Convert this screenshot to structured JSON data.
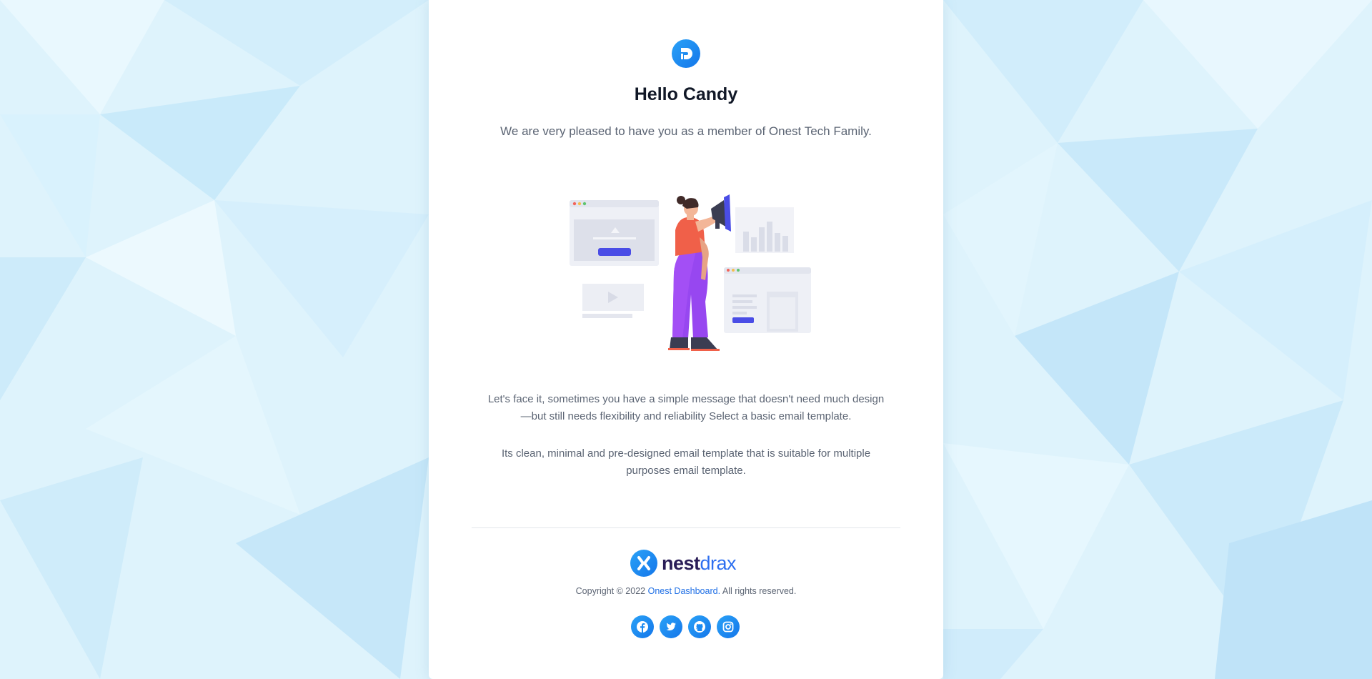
{
  "colors": {
    "accent": "#1a8af2",
    "brand_dark": "#2a1d57",
    "brand_light": "#2d6ff0",
    "text_heading": "#111827",
    "text_body": "#5b6473",
    "background": "#dff3fc"
  },
  "header": {
    "logo_icon": "onest-logo-icon",
    "greeting": "Hello Candy",
    "subtitle": "We are very pleased to have you as a member of Onest Tech Family."
  },
  "illustration": {
    "icon": "woman-with-megaphone-illustration"
  },
  "body": {
    "paragraph_1": "Let's face it, sometimes you have a simple message that doesn't need much design—but still needs flexibility and reliability Select a basic email template.",
    "paragraph_2": "Its clean, minimal and pre-designed email template that is suitable for multiple purposes email template."
  },
  "footer": {
    "brand_icon": "nestdrax-logo-icon",
    "brand_bold": "nest",
    "brand_light": "drax",
    "copyright_prefix": "Copyright © 2022",
    "copyright_link": "Onest Dashboard.",
    "copyright_suffix": "All rights reserved.",
    "social": [
      {
        "icon": "facebook-icon"
      },
      {
        "icon": "twitter-icon"
      },
      {
        "icon": "github-icon"
      },
      {
        "icon": "instagram-icon"
      }
    ]
  }
}
